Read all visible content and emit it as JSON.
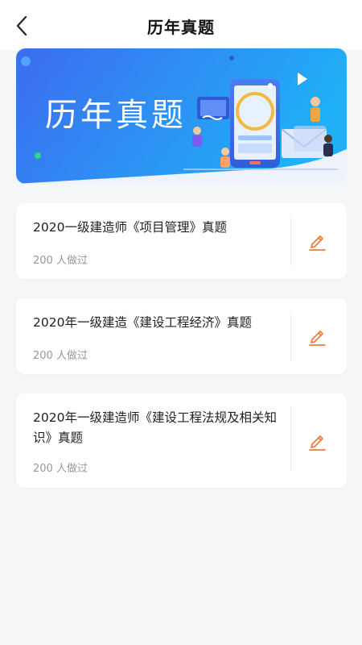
{
  "header": {
    "title": "历年真题",
    "back_icon": "back-arrow-icon"
  },
  "banner": {
    "title": "历年真题",
    "colors": {
      "primary": "#3d7bf0",
      "secondary": "#1fa8f5"
    }
  },
  "exams": [
    {
      "title": "2020一级建造师《项目管理》真题",
      "takers": "200 人做过",
      "action_icon": "edit-icon"
    },
    {
      "title": "2020年一级建造《建设工程经济》真题",
      "takers": "200 人做过",
      "action_icon": "edit-icon"
    },
    {
      "title": "2020年一级建造师《建设工程法规及相关知识》真题",
      "takers": "200 人做过",
      "action_icon": "edit-icon"
    }
  ],
  "accent_color": "#f07b3f"
}
